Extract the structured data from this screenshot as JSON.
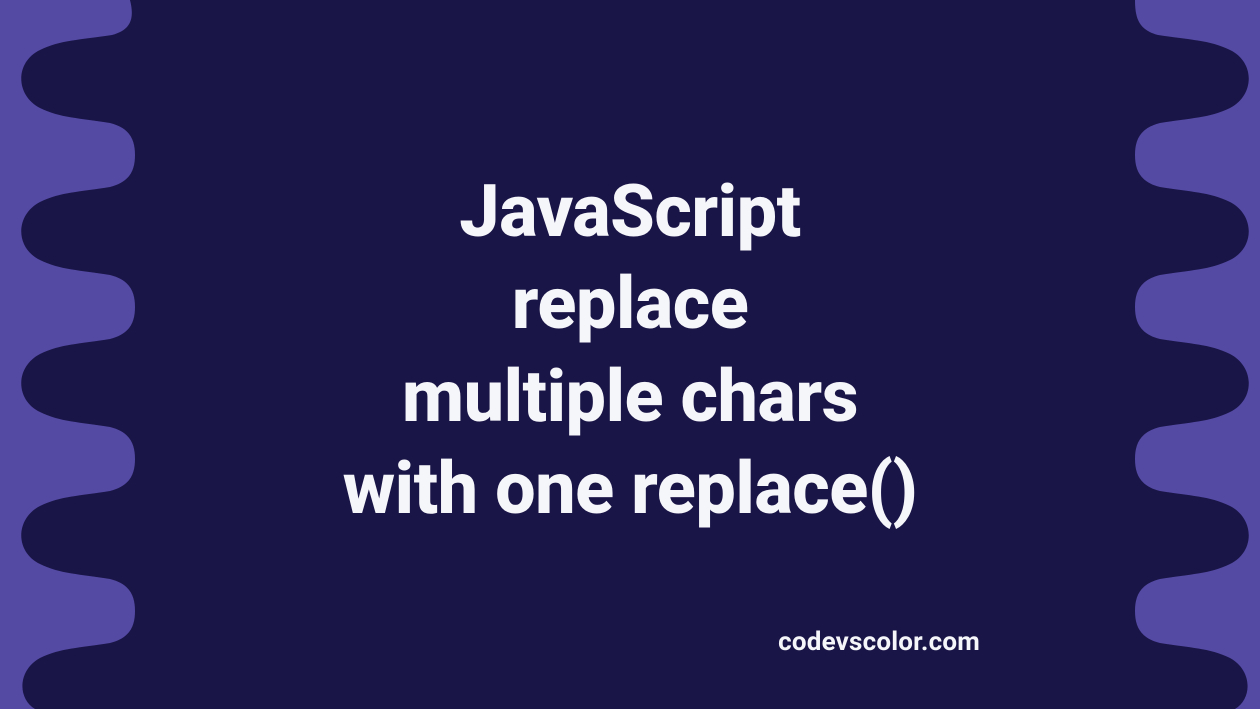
{
  "colors": {
    "background": "#5449a3",
    "blob": "#1a1547",
    "text": "#f5f6fa"
  },
  "title_lines": [
    "JavaScript",
    "replace",
    "multiple chars",
    "with one replace()"
  ],
  "credit": "codevscolor.com"
}
